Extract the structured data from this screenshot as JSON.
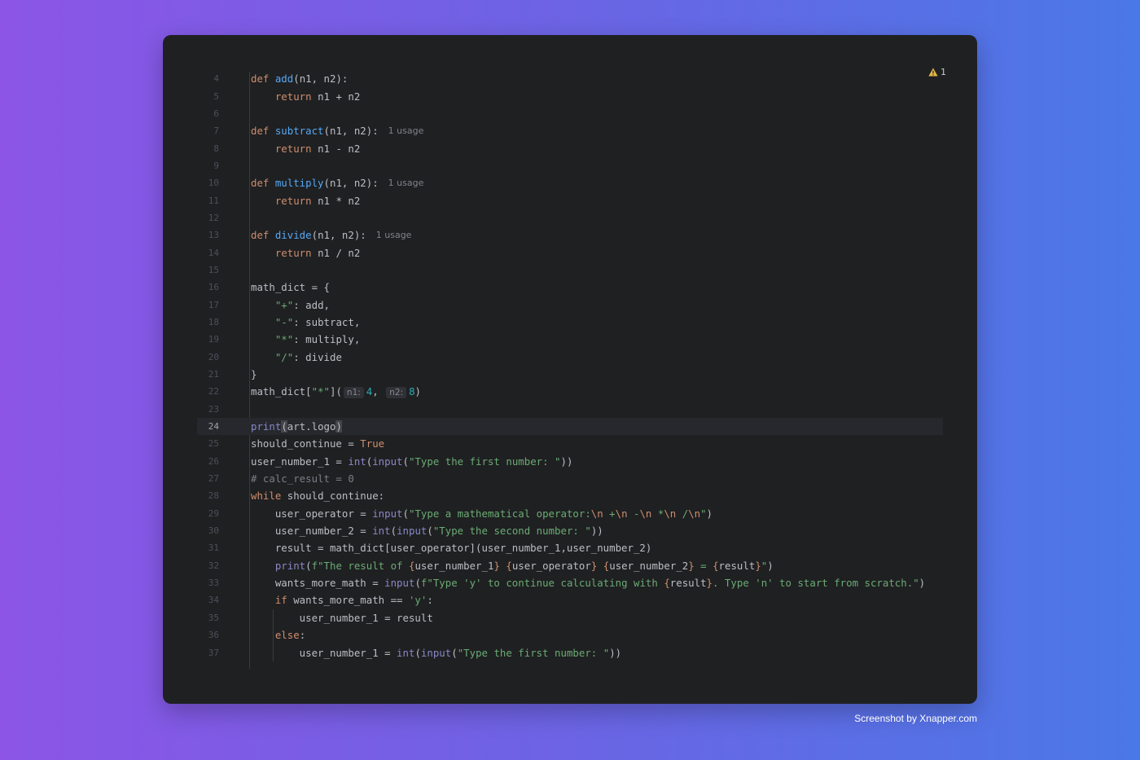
{
  "editor": {
    "warning_count": "1",
    "current_line": "24",
    "lines": [
      {
        "n": "4",
        "tokens": [
          {
            "t": "def ",
            "c": "kw"
          },
          {
            "t": "add",
            "c": "fn"
          },
          {
            "t": "(n1, n2):"
          }
        ]
      },
      {
        "n": "5",
        "tokens": [
          {
            "t": "    "
          },
          {
            "t": "return",
            "c": "kw"
          },
          {
            "t": " n1 + n2"
          }
        ]
      },
      {
        "n": "6",
        "tokens": []
      },
      {
        "n": "7",
        "tokens": [
          {
            "t": "def ",
            "c": "kw"
          },
          {
            "t": "subtract",
            "c": "fn"
          },
          {
            "t": "(n1, n2):"
          }
        ],
        "hint": "1 usage"
      },
      {
        "n": "8",
        "tokens": [
          {
            "t": "    "
          },
          {
            "t": "return",
            "c": "kw"
          },
          {
            "t": " n1 - n2"
          }
        ]
      },
      {
        "n": "9",
        "tokens": []
      },
      {
        "n": "10",
        "tokens": [
          {
            "t": "def ",
            "c": "kw"
          },
          {
            "t": "multiply",
            "c": "fn"
          },
          {
            "t": "(n1, n2):"
          }
        ],
        "hint": "1 usage"
      },
      {
        "n": "11",
        "tokens": [
          {
            "t": "    "
          },
          {
            "t": "return",
            "c": "kw"
          },
          {
            "t": " n1 * n2"
          }
        ]
      },
      {
        "n": "12",
        "tokens": []
      },
      {
        "n": "13",
        "tokens": [
          {
            "t": "def ",
            "c": "kw"
          },
          {
            "t": "divide",
            "c": "fn"
          },
          {
            "t": "(n1, n2):"
          }
        ],
        "hint": "1 usage"
      },
      {
        "n": "14",
        "tokens": [
          {
            "t": "    "
          },
          {
            "t": "return",
            "c": "kw"
          },
          {
            "t": " n1 / n2"
          }
        ]
      },
      {
        "n": "15",
        "tokens": []
      },
      {
        "n": "16",
        "tokens": [
          {
            "t": "math_dict = {"
          }
        ]
      },
      {
        "n": "17",
        "tokens": [
          {
            "t": "    "
          },
          {
            "t": "\"+\"",
            "c": "str"
          },
          {
            "t": ": add,"
          }
        ]
      },
      {
        "n": "18",
        "tokens": [
          {
            "t": "    "
          },
          {
            "t": "\"-\"",
            "c": "str"
          },
          {
            "t": ": subtract,"
          }
        ]
      },
      {
        "n": "19",
        "tokens": [
          {
            "t": "    "
          },
          {
            "t": "\"*\"",
            "c": "str"
          },
          {
            "t": ": multiply,"
          }
        ]
      },
      {
        "n": "20",
        "tokens": [
          {
            "t": "    "
          },
          {
            "t": "\"/\"",
            "c": "str"
          },
          {
            "t": ": divide"
          }
        ]
      },
      {
        "n": "21",
        "tokens": [
          {
            "t": "}"
          }
        ]
      },
      {
        "n": "22",
        "tokens": [
          {
            "t": "math_dict["
          },
          {
            "t": "\"*\"",
            "c": "str"
          },
          {
            "t": "]("
          },
          {
            "t": "n1:",
            "c": "param"
          },
          {
            "t": "4",
            "c": "num"
          },
          {
            "t": ", "
          },
          {
            "t": "n2:",
            "c": "param"
          },
          {
            "t": "8",
            "c": "num"
          },
          {
            "t": ")"
          }
        ]
      },
      {
        "n": "23",
        "tokens": []
      },
      {
        "n": "24",
        "tokens": [
          {
            "t": "print",
            "c": "bi"
          },
          {
            "t": "(",
            "c": "caret"
          },
          {
            "t": "art.logo"
          },
          {
            "t": ")",
            "c": "caret"
          }
        ]
      },
      {
        "n": "25",
        "tokens": [
          {
            "t": "should_continue = "
          },
          {
            "t": "True",
            "c": "kw"
          }
        ]
      },
      {
        "n": "26",
        "tokens": [
          {
            "t": "user_number_1 = "
          },
          {
            "t": "int",
            "c": "bi"
          },
          {
            "t": "("
          },
          {
            "t": "input",
            "c": "bi"
          },
          {
            "t": "("
          },
          {
            "t": "\"Type the first number: \"",
            "c": "str"
          },
          {
            "t": "))"
          }
        ]
      },
      {
        "n": "27",
        "tokens": [
          {
            "t": "# calc_result = 0",
            "c": "cm"
          }
        ]
      },
      {
        "n": "28",
        "tokens": [
          {
            "t": "while",
            "c": "kw"
          },
          {
            "t": " should_continue:"
          }
        ]
      },
      {
        "n": "29",
        "tokens": [
          {
            "t": "    user_operator = "
          },
          {
            "t": "input",
            "c": "bi"
          },
          {
            "t": "("
          },
          {
            "t": "\"Type a mathematical operator:",
            "c": "str"
          },
          {
            "t": "\\n",
            "c": "esc"
          },
          {
            "t": " +",
            "c": "str"
          },
          {
            "t": "\\n",
            "c": "esc"
          },
          {
            "t": " -",
            "c": "str"
          },
          {
            "t": "\\n",
            "c": "esc"
          },
          {
            "t": " *",
            "c": "str"
          },
          {
            "t": "\\n",
            "c": "esc"
          },
          {
            "t": " /",
            "c": "str"
          },
          {
            "t": "\\n",
            "c": "esc"
          },
          {
            "t": "\"",
            "c": "str"
          },
          {
            "t": ")"
          }
        ]
      },
      {
        "n": "30",
        "tokens": [
          {
            "t": "    user_number_2 = "
          },
          {
            "t": "int",
            "c": "bi"
          },
          {
            "t": "("
          },
          {
            "t": "input",
            "c": "bi"
          },
          {
            "t": "("
          },
          {
            "t": "\"Type the second number: \"",
            "c": "str"
          },
          {
            "t": "))"
          }
        ]
      },
      {
        "n": "31",
        "tokens": [
          {
            "t": "    result = math_dict[user_operator](user_number_1,user_number_2)"
          }
        ]
      },
      {
        "n": "32",
        "tokens": [
          {
            "t": "    "
          },
          {
            "t": "print",
            "c": "bi"
          },
          {
            "t": "("
          },
          {
            "t": "f\"The result of ",
            "c": "str"
          },
          {
            "t": "{",
            "c": "esc"
          },
          {
            "t": "user_number_1"
          },
          {
            "t": "}",
            "c": "esc"
          },
          {
            "t": " ",
            "c": "str"
          },
          {
            "t": "{",
            "c": "esc"
          },
          {
            "t": "user_operator"
          },
          {
            "t": "}",
            "c": "esc"
          },
          {
            "t": " ",
            "c": "str"
          },
          {
            "t": "{",
            "c": "esc"
          },
          {
            "t": "user_number_2"
          },
          {
            "t": "}",
            "c": "esc"
          },
          {
            "t": " = ",
            "c": "str"
          },
          {
            "t": "{",
            "c": "esc"
          },
          {
            "t": "result"
          },
          {
            "t": "}",
            "c": "esc"
          },
          {
            "t": "\"",
            "c": "str"
          },
          {
            "t": ")"
          }
        ]
      },
      {
        "n": "33",
        "tokens": [
          {
            "t": "    wants_more_math = "
          },
          {
            "t": "input",
            "c": "bi"
          },
          {
            "t": "("
          },
          {
            "t": "f\"Type 'y' to continue calculating with ",
            "c": "str"
          },
          {
            "t": "{",
            "c": "esc"
          },
          {
            "t": "result"
          },
          {
            "t": "}",
            "c": "esc"
          },
          {
            "t": ". Type 'n' to start from scratch.\"",
            "c": "str"
          },
          {
            "t": ")"
          }
        ]
      },
      {
        "n": "34",
        "tokens": [
          {
            "t": "    "
          },
          {
            "t": "if",
            "c": "kw"
          },
          {
            "t": " wants_more_math == "
          },
          {
            "t": "'y'",
            "c": "str"
          },
          {
            "t": ":"
          }
        ]
      },
      {
        "n": "35",
        "tokens": [
          {
            "t": "        user_number_1 = result"
          }
        ]
      },
      {
        "n": "36",
        "tokens": [
          {
            "t": "    "
          },
          {
            "t": "else",
            "c": "kw"
          },
          {
            "t": ":"
          }
        ]
      },
      {
        "n": "37",
        "tokens": [
          {
            "t": "        user_number_1 = "
          },
          {
            "t": "int",
            "c": "bi"
          },
          {
            "t": "("
          },
          {
            "t": "input",
            "c": "bi"
          },
          {
            "t": "("
          },
          {
            "t": "\"Type the first number: \"",
            "c": "str"
          },
          {
            "t": "))"
          }
        ]
      }
    ]
  },
  "footer": {
    "credit": "Screenshot by Xnapper.com"
  }
}
